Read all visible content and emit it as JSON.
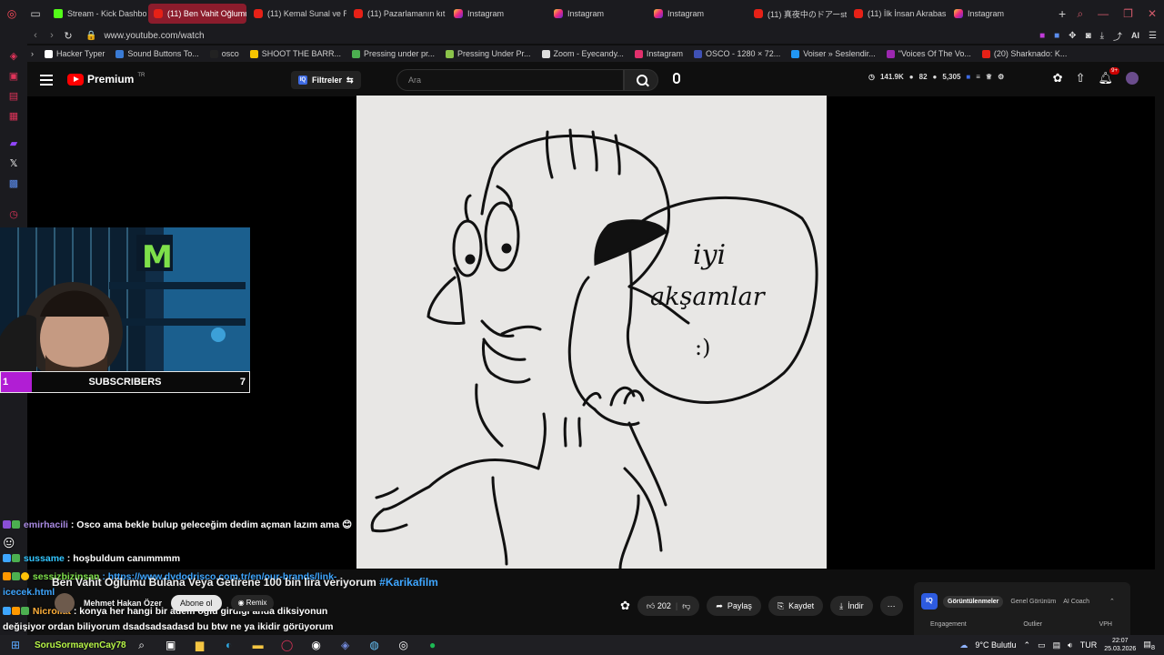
{
  "browser": {
    "tabs": [
      {
        "title": "Stream - Kick Dashbo",
        "icon": "kick",
        "active": false
      },
      {
        "title": "(11) Ben Vahit Oğlumu Bul",
        "icon": "youtube",
        "active": true
      },
      {
        "title": "(11) Kemal Sunal ve R",
        "icon": "youtube",
        "active": false
      },
      {
        "title": "(11) Pazarlamanın kıt",
        "icon": "youtube",
        "active": false
      },
      {
        "title": "Instagram",
        "icon": "instagram",
        "active": false
      },
      {
        "title": "Instagram",
        "icon": "instagram",
        "active": false
      },
      {
        "title": "Instagram",
        "icon": "instagram",
        "active": false
      },
      {
        "title": "(11) 真夜中のドアーstay",
        "icon": "youtube",
        "active": false
      },
      {
        "title": "(11) İlk İnsan Akrabası",
        "icon": "youtube",
        "active": false
      },
      {
        "title": "Instagram",
        "icon": "instagram",
        "active": false
      }
    ],
    "url": "www.youtube.com/watch",
    "ai_label": "AI",
    "bookmarks": [
      {
        "label": "Hacker Typer",
        "color": "#ffffff"
      },
      {
        "label": "Sound Buttons To...",
        "color": "#3a7bd5"
      },
      {
        "label": "osco",
        "color": "#222222"
      },
      {
        "label": "SHOOT THE BARR...",
        "color": "#f5c400"
      },
      {
        "label": "Pressing under pr...",
        "color": "#4caf50"
      },
      {
        "label": "Pressing Under Pr...",
        "color": "#8bc34a"
      },
      {
        "label": "Zoom - Eyecandy...",
        "color": "#dddddd"
      },
      {
        "label": "Instagram",
        "color": "#e1306c"
      },
      {
        "label": "OSCO - 1280 × 72...",
        "color": "#3f51b5"
      },
      {
        "label": "Voiser » Seslendir...",
        "color": "#2196f3"
      },
      {
        "label": "\"Voices Of The Vo...",
        "color": "#9c27b0"
      },
      {
        "label": "(20) Sharknado: K...",
        "color": "#e62117"
      }
    ]
  },
  "youtube": {
    "logo_text": "Premium",
    "region": "TR",
    "filters_label": "Filtreler",
    "search_placeholder": "Ara",
    "stats": {
      "views": "141.9K",
      "a": "82",
      "b": "5,305"
    },
    "notif_badge": "9+"
  },
  "drawing": {
    "speech_line1": "iyi",
    "speech_line2": "akşamlar",
    "smiley": ":)"
  },
  "stream_overlay": {
    "sub_left": "1",
    "sub_label": "SUBSCRIBERS",
    "sub_right": "7"
  },
  "chat": [
    {
      "user": "emirhacili",
      "message": ": Osco ama bekle bulup geleceğim dedim açman lazım ama"
    },
    {
      "user": "sussame",
      "message": ": hoşbuldum canımmmm"
    },
    {
      "user": "sessizbizinsan",
      "message": ": https://www.dvdodrisco.com.tr/en/our-brands/link-",
      "message2": "icecek.html"
    },
    {
      "user": "Nicroliat",
      "message": ": konya her hangi bir adem oğlu girdiği anda diksiyonun",
      "message2": "değişiyor ordan biliyorum dsadsadsadasd bu btw ne ya ikidir görüyorum"
    },
    {
      "user": "SoruSormayenCay78",
      "message": ""
    }
  ],
  "video": {
    "title": "Ben Vahit Oğlumu Bulana Veya Getirene 100 bin lira veriyorum",
    "hashtag": "#Karikafilm",
    "channel": "Mehmet Hakan Özer",
    "subscribe_label": "Abone ol",
    "remix_label": "Remix",
    "likes": "202",
    "share_label": "Paylaş",
    "save_label": "Kaydet",
    "download_label": "İndir"
  },
  "iq_panel": {
    "logo": "IQ",
    "tabs": [
      "Görüntülenmeler",
      "Genel Görünüm",
      "AI Coach"
    ],
    "columns": [
      "Engagement",
      "Outlier",
      "VPH"
    ]
  },
  "taskbar": {
    "weather": "9°C  Bulutlu",
    "lang": "TUR",
    "time": "22:07",
    "date": "25.03.2026",
    "notif_count": "8"
  }
}
